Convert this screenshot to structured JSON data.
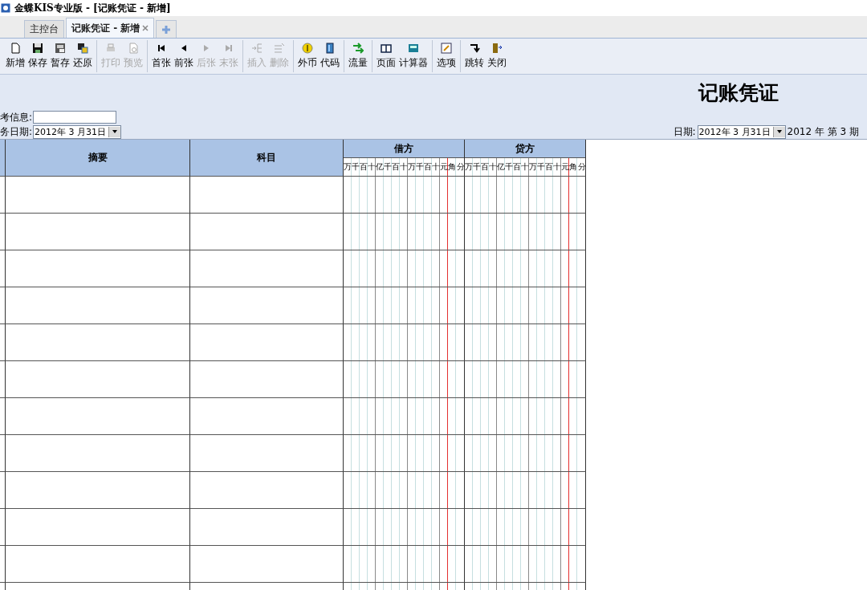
{
  "window": {
    "title": "金蝶KIS专业版 - [记账凭证 - 新增]"
  },
  "tabs": [
    {
      "label": "主控台",
      "selected": false,
      "closable": false
    },
    {
      "label": "记账凭证 - 新增",
      "selected": true,
      "closable": true
    }
  ],
  "toolbar": {
    "groups": [
      [
        {
          "label": "新增",
          "disabled": false
        },
        {
          "label": "保存",
          "disabled": false
        },
        {
          "label": "暂存",
          "disabled": false
        },
        {
          "label": "还原",
          "disabled": false
        }
      ],
      [
        {
          "label": "打印",
          "disabled": true
        },
        {
          "label": "预览",
          "disabled": true
        }
      ],
      [
        {
          "label": "首张",
          "disabled": false
        },
        {
          "label": "前张",
          "disabled": false
        },
        {
          "label": "后张",
          "disabled": true
        },
        {
          "label": "末张",
          "disabled": true
        }
      ],
      [
        {
          "label": "插入",
          "disabled": true
        },
        {
          "label": "删除",
          "disabled": true
        }
      ],
      [
        {
          "label": "外币",
          "disabled": false
        },
        {
          "label": "代码",
          "disabled": false
        }
      ],
      [
        {
          "label": "流量",
          "disabled": false
        }
      ],
      [
        {
          "label": "页面",
          "disabled": false
        },
        {
          "label": "计算器",
          "disabled": false
        }
      ],
      [
        {
          "label": "选项",
          "disabled": false
        }
      ],
      [
        {
          "label": "跳转",
          "disabled": false
        },
        {
          "label": "关闭",
          "disabled": false
        }
      ]
    ]
  },
  "header": {
    "title": "记账凭证",
    "reference_label": "考信息:",
    "business_date_label": "务日期:",
    "business_date": "2012年 3 月31日",
    "date_label": "日期:",
    "date": "2012年 3 月31日",
    "period": "2012 年 第 3 期"
  },
  "table": {
    "columns": [
      {
        "label": "摘要"
      },
      {
        "label": "科目"
      }
    ],
    "money_columns": [
      {
        "label": "借方",
        "digits": [
          "万",
          "千",
          "百",
          "十",
          "亿",
          "千",
          "百",
          "十",
          "万",
          "千",
          "百",
          "十",
          "元",
          "角",
          "分"
        ]
      },
      {
        "label": "贷方",
        "digits": [
          "万",
          "千",
          "百",
          "十",
          "亿",
          "千",
          "百",
          "十",
          "万",
          "千",
          "百",
          "十",
          "元",
          "角",
          "分"
        ]
      }
    ]
  }
}
